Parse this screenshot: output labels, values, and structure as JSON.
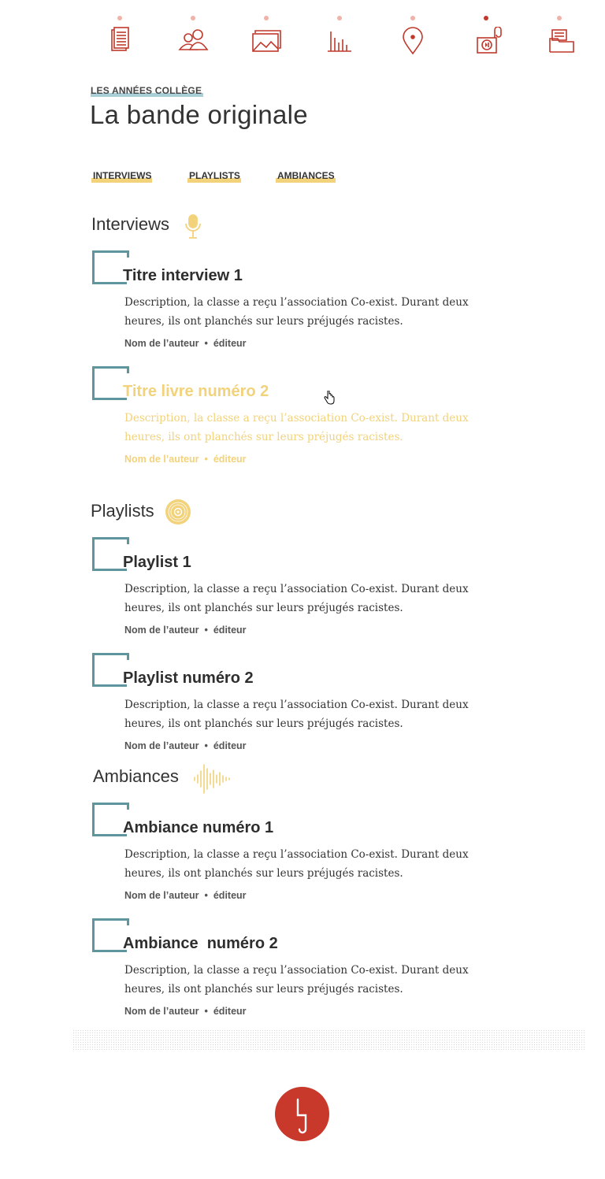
{
  "nav": {
    "items": [
      {
        "icon": "newspaper-icon",
        "active": false
      },
      {
        "icon": "people-icon",
        "active": false
      },
      {
        "icon": "images-icon",
        "active": false
      },
      {
        "icon": "bar-chart-icon",
        "active": false
      },
      {
        "icon": "location-pin-icon",
        "active": false
      },
      {
        "icon": "audio-player-icon",
        "active": true
      },
      {
        "icon": "folder-icon",
        "active": false
      }
    ],
    "accent_color": "#c0392b",
    "inactive_dot_color": "#f0b3a8"
  },
  "header": {
    "kicker": "LES ANNÉES COLLÈGE",
    "title": "La bande originale"
  },
  "tabs": [
    {
      "label": "INTERVIEWS"
    },
    {
      "label": "PLAYLISTS"
    },
    {
      "label": "AMBIANCES"
    }
  ],
  "sections": [
    {
      "heading": "Interviews",
      "icon": "microphone-icon",
      "items": [
        {
          "title": "Titre interview 1",
          "description": "Description, la classe a reçu l’association Co-exist. Durant deux heures, ils ont planchés sur leurs préjugés racistes.",
          "author": "Nom de l’auteur",
          "role": "éditeur",
          "state": "normal"
        },
        {
          "title": "Titre livre numéro 2",
          "description": "Description, la classe a reçu l’association Co-exist. Durant deux heures, ils ont planchés sur leurs préjugés racistes.",
          "author": "Nom de l’auteur",
          "role": "éditeur",
          "state": "hover"
        }
      ]
    },
    {
      "heading": "Playlists",
      "icon": "vinyl-disc-icon",
      "items": [
        {
          "title": "Playlist 1",
          "description": "Description, la classe a reçu l’association Co-exist. Durant deux heures, ils ont planchés sur leurs préjugés racistes.",
          "author": "Nom de l’auteur",
          "role": "éditeur",
          "state": "normal"
        },
        {
          "title": "Playlist numéro 2",
          "description": "Description, la classe a reçu l’association Co-exist. Durant deux heures, ils ont planchés sur leurs préjugés racistes.",
          "author": "Nom de l’auteur",
          "role": "éditeur",
          "state": "normal"
        }
      ]
    },
    {
      "heading": "Ambiances",
      "icon": "soundwave-icon",
      "items": [
        {
          "title": "Ambiance numéro 1",
          "description": "Description, la classe a reçu l’association Co-exist. Durant deux heures, ils ont planchés sur leurs préjugés racistes.",
          "author": "Nom de l’auteur",
          "role": "éditeur",
          "state": "normal"
        },
        {
          "title": "Ambiance  numéro 2",
          "description": "Description, la classe a reçu l’association Co-exist. Durant deux heures, ils ont planchés sur leurs préjugés racistes.",
          "author": "Nom de l’auteur",
          "role": "éditeur",
          "state": "normal"
        }
      ]
    }
  ],
  "colors": {
    "thumb_border": "#5f969e",
    "highlight_yellow": "#f2d27a",
    "kicker_underline": "#a9cfd6",
    "logo_red": "#c8392b"
  },
  "footer": {
    "logo": "brand-logo"
  }
}
